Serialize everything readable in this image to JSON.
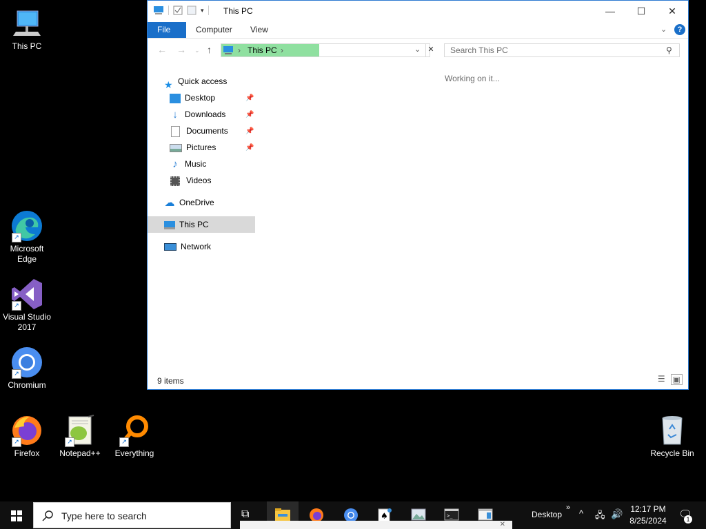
{
  "desktop": {
    "icons": [
      {
        "label": "This PC"
      },
      {
        "label": "Microsoft\nEdge"
      },
      {
        "label": "Visual Studio\n2017"
      },
      {
        "label": "Chromium"
      },
      {
        "label": "Firefox"
      },
      {
        "label": "Notepad++"
      },
      {
        "label": "Everything"
      },
      {
        "label": "Recycle Bin"
      }
    ]
  },
  "window": {
    "title": "This PC",
    "ribbon_tabs": [
      "File",
      "Computer",
      "View"
    ],
    "address": {
      "crumb": "This PC"
    },
    "search_placeholder": "Search This PC",
    "loading_text": "Working on it...",
    "status": "9 items",
    "nav": {
      "quick_access": "Quick access",
      "quick_items": [
        "Desktop",
        "Downloads",
        "Documents",
        "Pictures",
        "Music",
        "Videos"
      ],
      "onedrive": "OneDrive",
      "this_pc": "This PC",
      "network": "Network"
    }
  },
  "taskbar": {
    "search_placeholder": "Type here to search",
    "desktop_label": "Desktop",
    "time": "12:17 PM",
    "date": "8/25/2024",
    "notification_count": "1"
  },
  "colors": {
    "accent": "#1a6fc9",
    "address_highlight": "#8fe0a0",
    "selection": "#d9d9d9"
  }
}
